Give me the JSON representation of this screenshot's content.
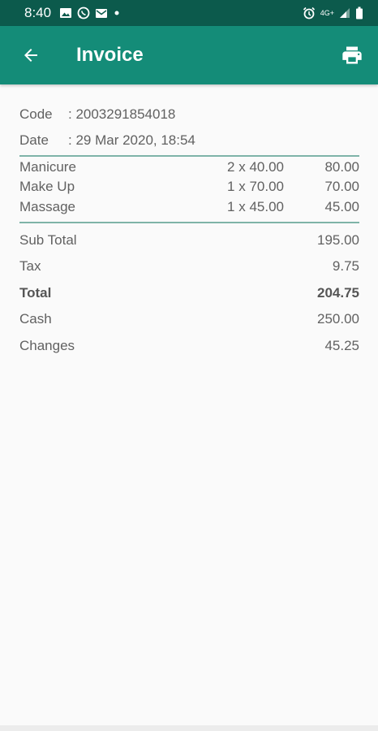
{
  "status_bar": {
    "time": "8:40",
    "network": "4G+",
    "icons": [
      "image-icon",
      "whatsapp-icon",
      "mail-icon",
      "dot-icon",
      "alarm-icon",
      "network-icon",
      "signal-icon",
      "battery-icon"
    ]
  },
  "app_bar": {
    "title": "Invoice",
    "back_icon": "back-arrow-icon",
    "print_icon": "print-icon",
    "color": "#148c78"
  },
  "invoice": {
    "code_label": "Code",
    "code_value": ": 2003291854018",
    "date_label": "Date",
    "date_value": ": 29 Mar 2020, 18:54",
    "items": [
      {
        "name": "Manicure",
        "qty": "2 x 40.00",
        "amount": "80.00"
      },
      {
        "name": "Make Up",
        "qty": "1 x 70.00",
        "amount": "70.00"
      },
      {
        "name": "Massage",
        "qty": "1 x 45.00",
        "amount": "45.00"
      }
    ],
    "summary": {
      "sub_total_label": "Sub Total",
      "sub_total_value": "195.00",
      "tax_label": "Tax",
      "tax_value": "9.75",
      "total_label": "Total",
      "total_value": "204.75",
      "cash_label": "Cash",
      "cash_value": "250.00",
      "changes_label": "Changes",
      "changes_value": "45.25"
    }
  }
}
